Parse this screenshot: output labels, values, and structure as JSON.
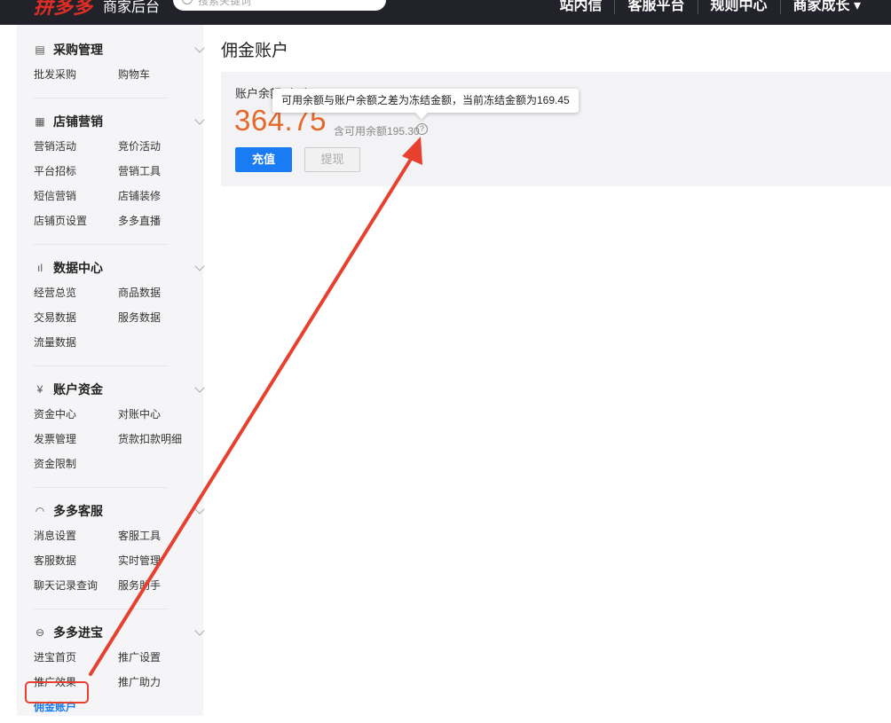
{
  "topbar": {
    "logo": "拼多多",
    "logo_sub": "商家后台",
    "search_placeholder": "搜索关键词",
    "nav": [
      "站内信",
      "客服平台",
      "规则中心",
      "商家成长 ▾"
    ]
  },
  "sidebar": {
    "groups": [
      {
        "icon": "purchase-icon",
        "title": "采购管理",
        "items": [
          "批发采购",
          "购物车"
        ]
      },
      {
        "icon": "calendar-icon",
        "title": "店铺营销",
        "items": [
          "营销活动",
          "竞价活动",
          "平台招标",
          "营销工具",
          "短信营销",
          "店铺装修",
          "店铺页设置",
          "多多直播"
        ]
      },
      {
        "icon": "chart-bars-icon",
        "title": "数据中心",
        "items": [
          "经营总览",
          "商品数据",
          "交易数据",
          "服务数据",
          "流量数据"
        ]
      },
      {
        "icon": "yen-circle-icon",
        "title": "账户资金",
        "items": [
          "资金中心",
          "对账中心",
          "发票管理",
          "货款扣款明细",
          "资金限制"
        ]
      },
      {
        "icon": "headset-icon",
        "title": "多多客服",
        "items": [
          "消息设置",
          "客服工具",
          "客服数据",
          "实时管理",
          "聊天记录查询",
          "服务助手"
        ]
      },
      {
        "icon": "basket-icon",
        "title": "多多进宝",
        "items": [
          "进宝首页",
          "推广设置",
          "推广效果",
          "推广助力",
          "佣金账户"
        ]
      }
    ],
    "active_item": "佣金账户"
  },
  "main": {
    "page_title": "佣金账户",
    "balance_label": "账户余额（元）",
    "balance_amount": "364.75",
    "available_text": "含可用余额195.30",
    "tooltip": "可用余额与账户余额之差为冻结金额，当前冻结金额为169.45",
    "recharge_label": "充值",
    "withdraw_label": "提现"
  },
  "colors": {
    "accent": "#1a7cf5",
    "amount": "#e6672a",
    "annotation": "#e8402f",
    "topbar": "#22232a"
  }
}
